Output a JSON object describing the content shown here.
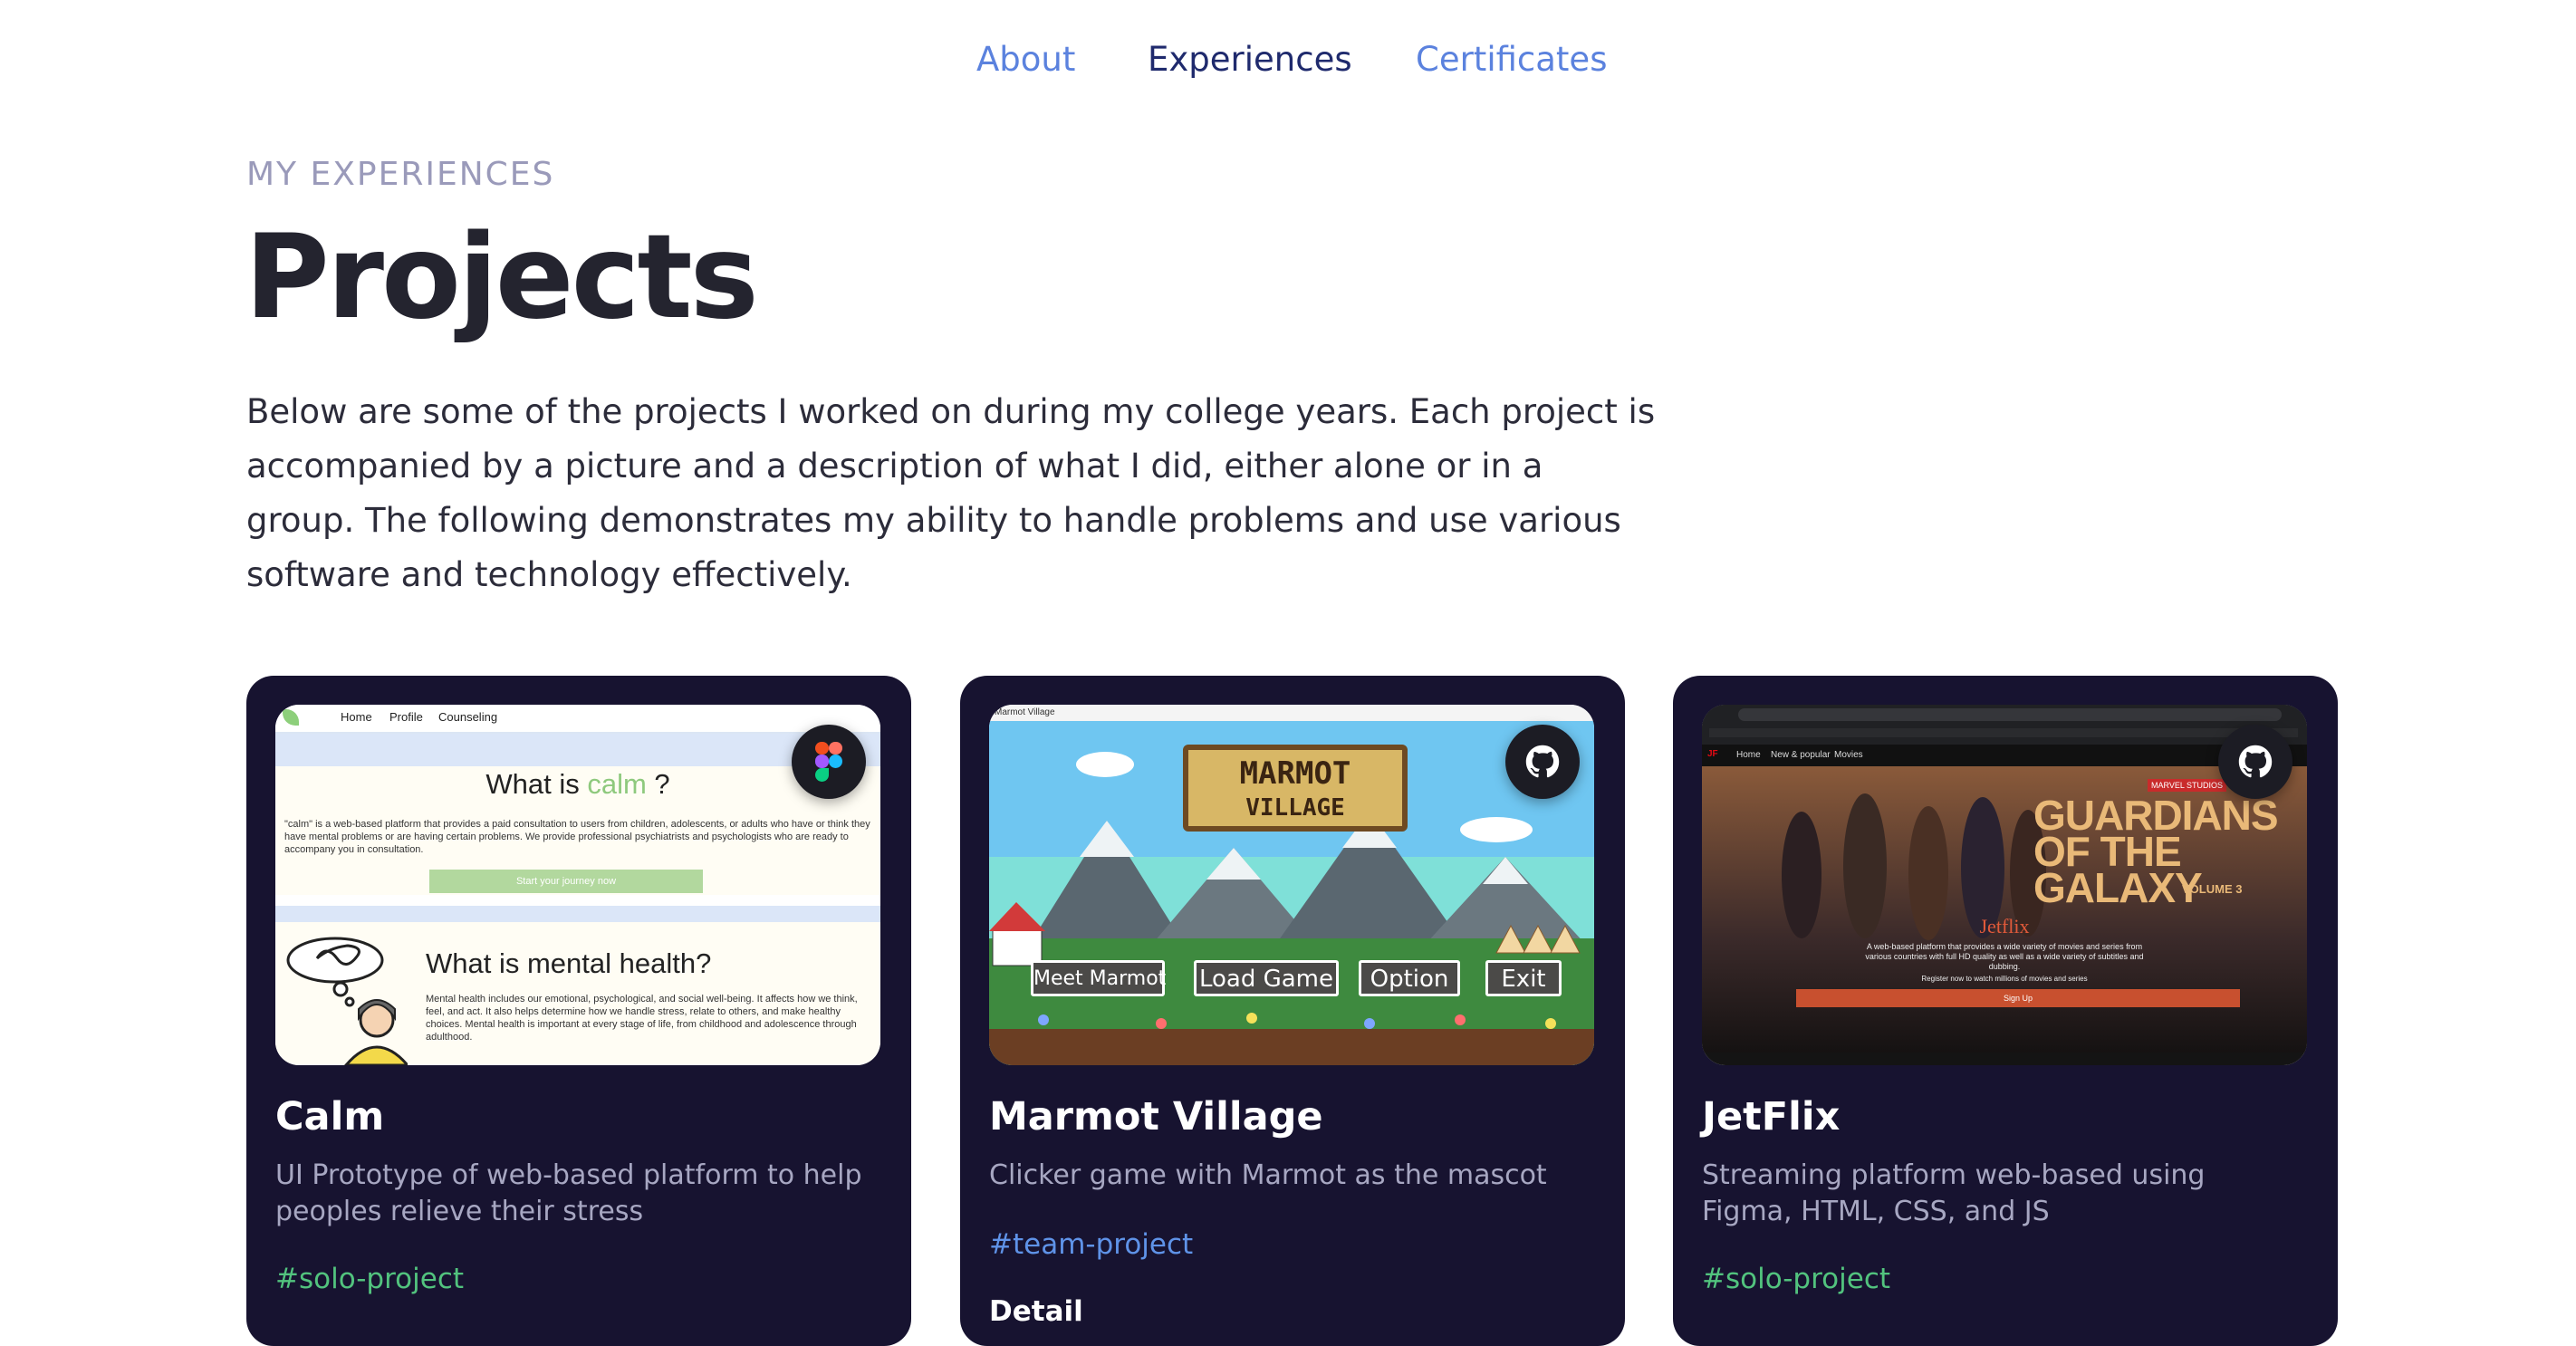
{
  "nav": {
    "about": "About",
    "experiences": "Experiences",
    "certificates": "Certificates",
    "active": "Experiences"
  },
  "colors": {
    "nav_active": "#1f2a6d",
    "nav_inactive": "#5b82de",
    "card_bg": "#171330",
    "tag_solo": "#52c37e",
    "tag_team": "#5f93e8"
  },
  "header": {
    "eyebrow": "MY EXPERIENCES",
    "title": "Projects",
    "intro": "Below are some of the projects I worked on during my college years. Each project is accompanied by a picture and a description of what I did, either alone or in a group. The following demonstrates my ability to handle problems and use various software and technology effectively."
  },
  "projects": [
    {
      "name": "Calm",
      "description": "UI Prototype of web-based platform to help peoples relieve their stress",
      "tag": "#solo-project",
      "badge_icon": "figma-icon",
      "preview": {
        "nav": [
          "Home",
          "Profile",
          "Counseling"
        ],
        "q_prefix": "What is ",
        "q_word": "calm",
        "q_suffix": " ?",
        "paragraph": "\"calm\" is a web-based platform that provides a paid consultation to users from children, adolescents, or adults who have or think they have mental problems or are having certain problems. We provide professional psychiatrists and psychologists who are ready to accompany you in consultation.",
        "button": "Start your journey now",
        "mh_title": "What is mental health?",
        "mh_paragraph": "Mental health includes our emotional, psychological, and social well-being. It affects how we think, feel, and act. It also helps determine how we handle stress, relate to others, and make healthy choices. Mental health is important at every stage of life, from childhood and adolescence through adulthood."
      }
    },
    {
      "name": "Marmot Village",
      "description": "Clicker game with Marmot as the mascot",
      "tag": "#team-project",
      "detail": "Detail",
      "badge_icon": "github-icon",
      "preview": {
        "window_title": "Marmot Village",
        "logo_line1": "MARMOT",
        "logo_line2": "VILLAGE",
        "buttons": [
          "Meet Marmot",
          "Load Game",
          "Option",
          "Exit"
        ]
      }
    },
    {
      "name": "JetFlix",
      "description": "Streaming platform web-based using Figma, HTML, CSS, and JS",
      "tag": "#solo-project",
      "badge_icon": "github-icon",
      "preview": {
        "nav": [
          "Home",
          "New & popular",
          "Movies"
        ],
        "studio": "MARVEL STUDIOS",
        "movie_title": "GUARDIANS OF THE GALAXY",
        "volume": "VOLUME 3",
        "brand": "Jetflix",
        "text": "A web-based platform that provides a wide variety of movies and series from various countries with full HD quality as well as a wide variety of subtitles and dubbing.",
        "register": "Register now to watch millions of movies and series",
        "button": "Sign Up"
      }
    }
  ]
}
